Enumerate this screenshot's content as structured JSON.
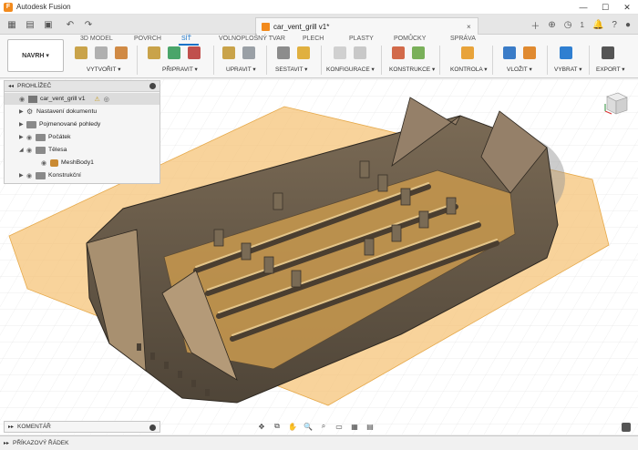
{
  "window": {
    "title": "Autodesk Fusion",
    "controls": {
      "minimize": "—",
      "maximize": "☐",
      "close": "✕"
    }
  },
  "document": {
    "tab_name": "car_vent_grill v1*",
    "close_glyph": "×",
    "notification_count": "1"
  },
  "ribbon": {
    "workspace_button": "NAVRH ▾",
    "tabs": [
      "3D MODEL",
      "POVRCH",
      "SÍŤ",
      "VOLNOPLOŠNÝ TVAR",
      "PLECH",
      "PLASTY",
      "POMŮCKY",
      "SPRÁVA"
    ],
    "active_tab": "SÍŤ",
    "groups": [
      "VYTVOŘIT ▾",
      "PŘIPRAVIT ▾",
      "UPRAVIT ▾",
      "SESTAVIT ▾",
      "KONFIGURACE ▾",
      "KONSTRUKCE ▾",
      "KONTROLA ▾",
      "VLOŽIT ▾",
      "VYBRAT ▾",
      "EXPORT ▾"
    ],
    "accent_color": "#1a73c8"
  },
  "browser": {
    "title": "PROHLÍŽEČ",
    "root": "car_vent_grill v1",
    "nodes": [
      {
        "label": "Nastavení dokumentu",
        "icon": "gear-icon"
      },
      {
        "label": "Pojmenované pohledy",
        "icon": "folder-icon"
      },
      {
        "label": "Počátek",
        "icon": "folder-icon"
      },
      {
        "label": "Tělesa",
        "icon": "folder-icon"
      },
      {
        "label": "MeshBody1",
        "icon": "mesh-body-icon"
      },
      {
        "label": "Konstrukční",
        "icon": "folder-icon"
      }
    ]
  },
  "comments": {
    "title": "KOMENTÁŘ"
  },
  "command_line": {
    "title": "PŘÍKAZOVÝ ŘÁDEK"
  },
  "viewport": {
    "model_color": "#8b7355",
    "plane_color": "#f5c47a",
    "viewcube_label": "cube"
  }
}
